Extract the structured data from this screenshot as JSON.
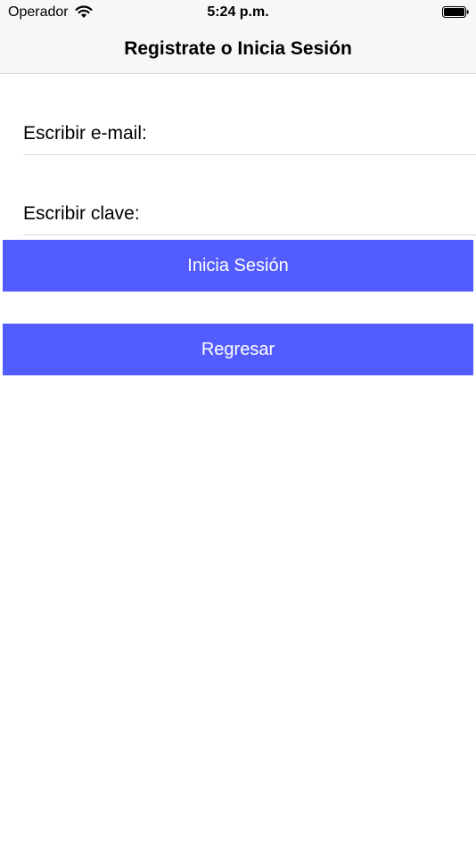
{
  "status_bar": {
    "carrier": "Operador",
    "time": "5:24 p.m.",
    "wifi_icon": "wifi-icon",
    "battery_icon": "battery-icon"
  },
  "nav": {
    "title": "Registrate o Inicia Sesión"
  },
  "form": {
    "email_placeholder": "Escribir e-mail:",
    "email_value": "",
    "password_placeholder": "Escribir clave:",
    "password_value": ""
  },
  "buttons": {
    "login_label": "Inicia Sesión",
    "back_label": "Regresar"
  },
  "colors": {
    "button_bg": "#525cff",
    "button_text": "#ffffff",
    "bar_bg": "#f7f7f7"
  }
}
